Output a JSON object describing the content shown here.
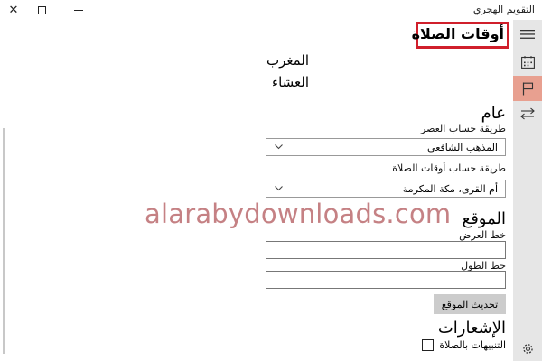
{
  "window": {
    "title": "التقويم الهجري",
    "close_glyph": "✕"
  },
  "page": {
    "title": "أوقات الصلاة"
  },
  "prayers": [
    "المغرب",
    "العشاء"
  ],
  "general": {
    "heading": "عام",
    "asr_label": "طريقة حساب العصر",
    "asr_value": "المذهب الشافعي",
    "method_label": "طريقة حساب أوقات الصلاة",
    "method_value": "أم القرى، مكة المكرمة"
  },
  "location": {
    "heading": "الموقع",
    "latitude_label": "خط العرض",
    "latitude_value": "",
    "longitude_label": "خط الطول",
    "longitude_value": "",
    "update_button": "تحديث الموقع"
  },
  "notifications": {
    "heading": "الإشعارات",
    "prayer_alerts_label": "التنبيهات بالصلاة"
  },
  "watermark": "alarabydownloads.com",
  "colors": {
    "highlight": "#d01f2b",
    "rail": "#e6e6e6",
    "rail_active": "#e8a090",
    "watermark": "#af5055"
  },
  "icons": {
    "rail": [
      "hamburger-icon",
      "calendar-icon",
      "flag-icon",
      "swap-icon",
      "gear-icon"
    ]
  }
}
